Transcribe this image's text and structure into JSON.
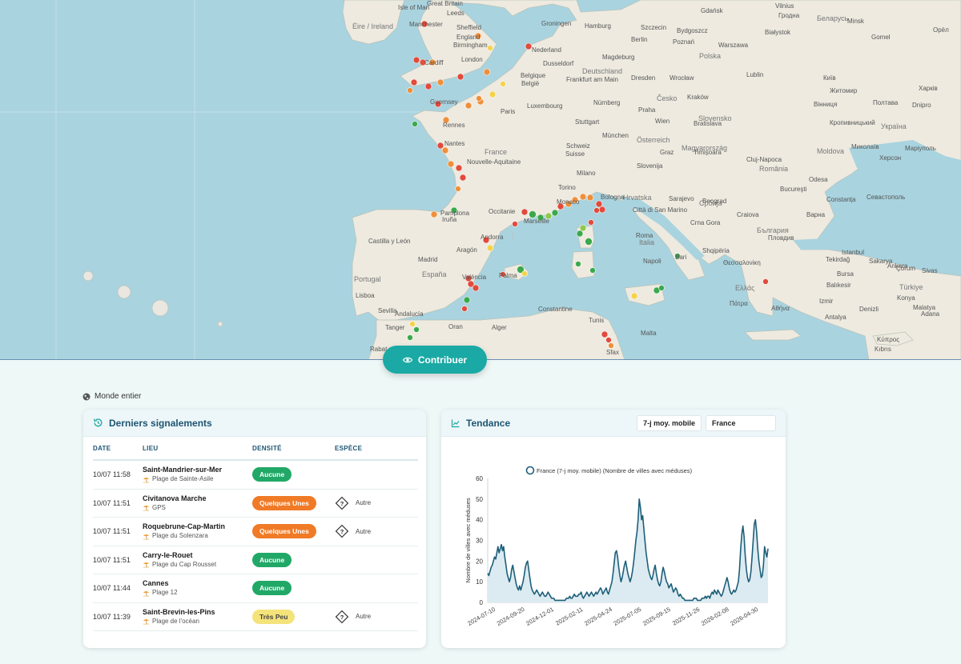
{
  "map": {
    "labels": [
      {
        "text": "Isle of Man",
        "cls": ""
      },
      {
        "text": "Great Britain",
        "cls": ""
      },
      {
        "text": "Leeds",
        "cls": ""
      },
      {
        "text": "Manchester",
        "cls": ""
      },
      {
        "text": "Sheffield",
        "cls": ""
      },
      {
        "text": "Éire / Ireland",
        "cls": "country"
      },
      {
        "text": "England",
        "cls": ""
      },
      {
        "text": "Birmingham",
        "cls": ""
      },
      {
        "text": "Cardiff",
        "cls": ""
      },
      {
        "text": "London",
        "cls": ""
      },
      {
        "text": "Groningen",
        "cls": ""
      },
      {
        "text": "Hamburg",
        "cls": ""
      },
      {
        "text": "Szczecin",
        "cls": ""
      },
      {
        "text": "Bydgoszcz",
        "cls": ""
      },
      {
        "text": "Gdańsk",
        "cls": ""
      },
      {
        "text": "Vilnius",
        "cls": ""
      },
      {
        "text": "Гродна",
        "cls": ""
      },
      {
        "text": "Беларусь",
        "cls": "country"
      },
      {
        "text": "Minsk",
        "cls": ""
      },
      {
        "text": "Орёл",
        "cls": ""
      },
      {
        "text": "Nederland",
        "cls": ""
      },
      {
        "text": "Berlin",
        "cls": ""
      },
      {
        "text": "Poznań",
        "cls": ""
      },
      {
        "text": "Warszawa",
        "cls": ""
      },
      {
        "text": "Białystok",
        "cls": ""
      },
      {
        "text": "Gomel",
        "cls": ""
      },
      {
        "text": "Dusseldorf",
        "cls": ""
      },
      {
        "text": "Deutschland",
        "cls": "country"
      },
      {
        "text": "Magdeburg",
        "cls": ""
      },
      {
        "text": "Polska",
        "cls": "country"
      },
      {
        "text": "Lublin",
        "cls": ""
      },
      {
        "text": "Київ",
        "cls": ""
      },
      {
        "text": "Україна",
        "cls": "country"
      },
      {
        "text": "Харків",
        "cls": ""
      },
      {
        "text": "Belgique",
        "cls": ""
      },
      {
        "text": "België",
        "cls": ""
      },
      {
        "text": "Frankfurt am Main",
        "cls": ""
      },
      {
        "text": "Dresden",
        "cls": ""
      },
      {
        "text": "Wrocław",
        "cls": ""
      },
      {
        "text": "Kraków",
        "cls": ""
      },
      {
        "text": "Житомир",
        "cls": ""
      },
      {
        "text": "Полтава",
        "cls": ""
      },
      {
        "text": "Luxembourg",
        "cls": ""
      },
      {
        "text": "Česko",
        "cls": "country"
      },
      {
        "text": "Slovensko",
        "cls": "country"
      },
      {
        "text": "Вінниця",
        "cls": ""
      },
      {
        "text": "Paris",
        "cls": ""
      },
      {
        "text": "Nürnberg",
        "cls": ""
      },
      {
        "text": "Praha",
        "cls": ""
      },
      {
        "text": "Dnipro",
        "cls": ""
      },
      {
        "text": "Rennes",
        "cls": ""
      },
      {
        "text": "Stuttgart",
        "cls": ""
      },
      {
        "text": "Wien",
        "cls": ""
      },
      {
        "text": "Bratislava",
        "cls": ""
      },
      {
        "text": "Кропивницький",
        "cls": ""
      },
      {
        "text": "Guernsey",
        "cls": ""
      },
      {
        "text": "Nantes",
        "cls": ""
      },
      {
        "text": "France",
        "cls": "country"
      },
      {
        "text": "München",
        "cls": ""
      },
      {
        "text": "Österreich",
        "cls": "country"
      },
      {
        "text": "Magyarország",
        "cls": "country"
      },
      {
        "text": "Миколаїв",
        "cls": ""
      },
      {
        "text": "Маріуполь",
        "cls": ""
      },
      {
        "text": "Schweiz",
        "cls": ""
      },
      {
        "text": "Suisse",
        "cls": ""
      },
      {
        "text": "Graz",
        "cls": ""
      },
      {
        "text": "Moldova",
        "cls": "country"
      },
      {
        "text": "Херсон",
        "cls": ""
      },
      {
        "text": "Nouvelle-Aquitaine",
        "cls": ""
      },
      {
        "text": "Milano",
        "cls": ""
      },
      {
        "text": "Slovenija",
        "cls": ""
      },
      {
        "text": "Timișoara",
        "cls": ""
      },
      {
        "text": "Cluj-Napoca",
        "cls": ""
      },
      {
        "text": "România",
        "cls": "country"
      },
      {
        "text": "Odesa",
        "cls": ""
      },
      {
        "text": "Torino",
        "cls": ""
      },
      {
        "text": "Hrvatska",
        "cls": "country"
      },
      {
        "text": "Beograd",
        "cls": ""
      },
      {
        "text": "Bucureşti",
        "cls": ""
      },
      {
        "text": "Constanța",
        "cls": ""
      },
      {
        "text": "Севастополь",
        "cls": ""
      },
      {
        "text": "Bologna",
        "cls": ""
      },
      {
        "text": "Sarajevo",
        "cls": ""
      },
      {
        "text": "Србија",
        "cls": "country"
      },
      {
        "text": "Craiova",
        "cls": ""
      },
      {
        "text": "Варна",
        "cls": ""
      },
      {
        "text": "Occitanie",
        "cls": ""
      },
      {
        "text": "Monaco",
        "cls": ""
      },
      {
        "text": "Città di San Marino",
        "cls": ""
      },
      {
        "text": "Crna Gora",
        "cls": ""
      },
      {
        "text": "България",
        "cls": "country"
      },
      {
        "text": "Pamplona",
        "cls": ""
      },
      {
        "text": "Iruña",
        "cls": ""
      },
      {
        "text": "Marseille",
        "cls": ""
      },
      {
        "text": "Italia",
        "cls": "country"
      },
      {
        "text": "Shqipëria",
        "cls": ""
      },
      {
        "text": "Пловдив",
        "cls": ""
      },
      {
        "text": "Istanbul",
        "cls": ""
      },
      {
        "text": "Andorra",
        "cls": ""
      },
      {
        "text": "Roma",
        "cls": ""
      },
      {
        "text": "Tekirdağ",
        "cls": ""
      },
      {
        "text": "Sakarya",
        "cls": ""
      },
      {
        "text": "Ankara",
        "cls": ""
      },
      {
        "text": "Çorum",
        "cls": ""
      },
      {
        "text": "Castilla y León",
        "cls": ""
      },
      {
        "text": "Madrid",
        "cls": ""
      },
      {
        "text": "Aragón",
        "cls": ""
      },
      {
        "text": "Napoli",
        "cls": ""
      },
      {
        "text": "Bari",
        "cls": ""
      },
      {
        "text": "Θεσσαλονίκη",
        "cls": ""
      },
      {
        "text": "Bursa",
        "cls": ""
      },
      {
        "text": "Sivas",
        "cls": ""
      },
      {
        "text": "Portugal",
        "cls": "country"
      },
      {
        "text": "España",
        "cls": "country"
      },
      {
        "text": "València",
        "cls": ""
      },
      {
        "text": "Palma",
        "cls": ""
      },
      {
        "text": "Ελλάς",
        "cls": "country"
      },
      {
        "text": "Balıkesir",
        "cls": ""
      },
      {
        "text": "Türkiye",
        "cls": "country"
      },
      {
        "text": "Lisboa",
        "cls": ""
      },
      {
        "text": "Sevilla",
        "cls": ""
      },
      {
        "text": "Andalucía",
        "cls": ""
      },
      {
        "text": "Πάτρα",
        "cls": ""
      },
      {
        "text": "Αθήνα",
        "cls": ""
      },
      {
        "text": "Izmir",
        "cls": ""
      },
      {
        "text": "Konya",
        "cls": ""
      },
      {
        "text": "Malatya",
        "cls": ""
      },
      {
        "text": "Constantine",
        "cls": ""
      },
      {
        "text": "Denizli",
        "cls": ""
      },
      {
        "text": "Adana",
        "cls": ""
      },
      {
        "text": "Tanger",
        "cls": ""
      },
      {
        "text": "Oran",
        "cls": ""
      },
      {
        "text": "Alger",
        "cls": ""
      },
      {
        "text": "Tunis",
        "cls": ""
      },
      {
        "text": "Malta",
        "cls": ""
      },
      {
        "text": "Antalya",
        "cls": ""
      },
      {
        "text": "Rabat",
        "cls": ""
      },
      {
        "text": "Sfax",
        "cls": ""
      },
      {
        "text": "Κύπρος",
        "cls": ""
      },
      {
        "text": "Kıbrıs",
        "cls": ""
      }
    ]
  },
  "contribute": {
    "label": "Contribuer"
  },
  "scope": {
    "label": "Monde entier"
  },
  "reports": {
    "title": "Derniers signalements",
    "columns": {
      "date": "DATE",
      "place": "LIEU",
      "density": "DENSITÉ",
      "species": "ESPÈCE"
    },
    "rows": [
      {
        "date": "10/07 11:58",
        "place": "Saint-Mandrier-sur-Mer",
        "beach": "Plage de Sainte-Asile",
        "density": "Aucune",
        "density_color": "green",
        "species": ""
      },
      {
        "date": "10/07 11:51",
        "place": "Civitanova Marche",
        "beach": "GPS",
        "density": "Quelques Unes",
        "density_color": "orange",
        "species": "Autre"
      },
      {
        "date": "10/07 11:51",
        "place": "Roquebrune-Cap-Martin",
        "beach": "Plage du Solenzara",
        "density": "Quelques Unes",
        "density_color": "orange",
        "species": "Autre"
      },
      {
        "date": "10/07 11:51",
        "place": "Carry-le-Rouet",
        "beach": "Plage du Cap Rousset",
        "density": "Aucune",
        "density_color": "green",
        "species": ""
      },
      {
        "date": "10/07 11:44",
        "place": "Cannes",
        "beach": "Plage 12",
        "density": "Aucune",
        "density_color": "green",
        "species": ""
      },
      {
        "date": "10/07 11:39",
        "place": "Saint-Brevin-les-Pins",
        "beach": "Plage de l'océan",
        "density": "Très Peu",
        "density_color": "yellow",
        "species": "Autre"
      }
    ]
  },
  "trend": {
    "title": "Tendance",
    "mode_select": "7-j moy. mobile",
    "country_select": "France"
  },
  "chart_data": {
    "type": "area",
    "legend": "France (7-j moy. mobile) (Nombre de villes avec méduses)",
    "ylabel": "Nombre de villes avec méduses",
    "xlabel": "",
    "ylim": [
      0,
      60
    ],
    "yticks": [
      0,
      10,
      20,
      30,
      40,
      50,
      60
    ],
    "xticks": [
      "2024-07-10",
      "2024-09-20",
      "2024-12-01",
      "2025-02-11",
      "2025-04-24",
      "2025-07-05",
      "2025-09-15",
      "2025-11-26",
      "2026-02-08",
      "2026-04-30"
    ],
    "color": "#1d5f7a",
    "values": [
      14,
      13,
      15,
      17,
      18,
      20,
      22,
      21,
      24,
      27,
      24,
      26,
      28,
      25,
      27,
      22,
      18,
      14,
      12,
      10,
      12,
      16,
      18,
      15,
      12,
      9,
      7,
      6,
      8,
      6,
      8,
      10,
      13,
      17,
      19,
      20,
      16,
      12,
      8,
      6,
      5,
      4,
      5,
      6,
      5,
      4,
      3,
      4,
      5,
      4,
      3,
      3,
      4,
      5,
      4,
      3,
      2,
      2,
      2,
      1,
      1,
      1,
      1,
      1,
      1,
      1,
      1,
      1,
      1,
      2,
      2,
      2,
      3,
      2,
      2,
      3,
      4,
      3,
      3,
      3,
      4,
      4,
      5,
      3,
      2,
      3,
      4,
      5,
      4,
      3,
      4,
      5,
      4,
      3,
      4,
      5,
      4,
      5,
      6,
      7,
      6,
      4,
      5,
      6,
      7,
      5,
      4,
      6,
      8,
      10,
      14,
      19,
      24,
      25,
      22,
      17,
      13,
      10,
      12,
      15,
      18,
      20,
      17,
      14,
      12,
      10,
      12,
      15,
      19,
      24,
      30,
      34,
      40,
      50,
      46,
      40,
      42,
      36,
      30,
      24,
      20,
      16,
      14,
      12,
      11,
      13,
      16,
      18,
      14,
      11,
      9,
      8,
      10,
      14,
      17,
      15,
      12,
      10,
      9,
      7,
      8,
      9,
      7,
      5,
      6,
      7,
      6,
      4,
      3,
      4,
      3,
      2,
      2,
      1,
      1,
      1,
      1,
      1,
      1,
      1,
      1,
      2,
      2,
      2,
      1,
      1,
      1,
      1,
      2,
      2,
      2,
      3,
      2,
      3,
      3,
      2,
      4,
      5,
      4,
      6,
      5,
      4,
      6,
      5,
      4,
      3,
      4,
      6,
      8,
      10,
      12,
      10,
      7,
      5,
      4,
      5,
      6,
      5,
      6,
      8,
      10,
      16,
      26,
      33,
      37,
      32,
      23,
      16,
      12,
      10,
      11,
      15,
      22,
      30,
      38,
      40,
      34,
      26,
      20,
      16,
      12,
      13,
      18,
      27,
      24,
      22,
      26
    ]
  }
}
